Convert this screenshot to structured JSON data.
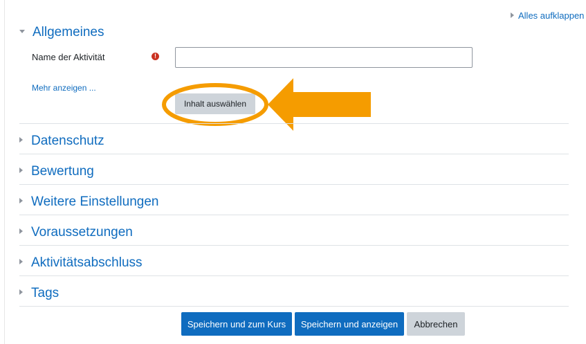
{
  "header": {
    "expand_all": "Alles aufklappen"
  },
  "general": {
    "title": "Allgemeines",
    "name_label": "Name der Aktivität",
    "name_value": "",
    "required_icon": "exclamation-circle-icon",
    "more_link": "Mehr anzeigen ...",
    "content_button": "Inhalt auswählen"
  },
  "sections": [
    {
      "label": "Datenschutz"
    },
    {
      "label": "Bewertung"
    },
    {
      "label": "Weitere Einstellungen"
    },
    {
      "label": "Voraussetzungen"
    },
    {
      "label": "Aktivitätsabschluss"
    },
    {
      "label": "Tags"
    }
  ],
  "footer": {
    "save_return": "Speichern und zum Kurs",
    "save_display": "Speichern und anzeigen",
    "cancel": "Abbrechen"
  },
  "colors": {
    "link": "#0f6cbf",
    "primary_button": "#0f6cbf",
    "secondary_button": "#ced4da",
    "required": "#ca3120",
    "annotation": "#f59c00"
  }
}
